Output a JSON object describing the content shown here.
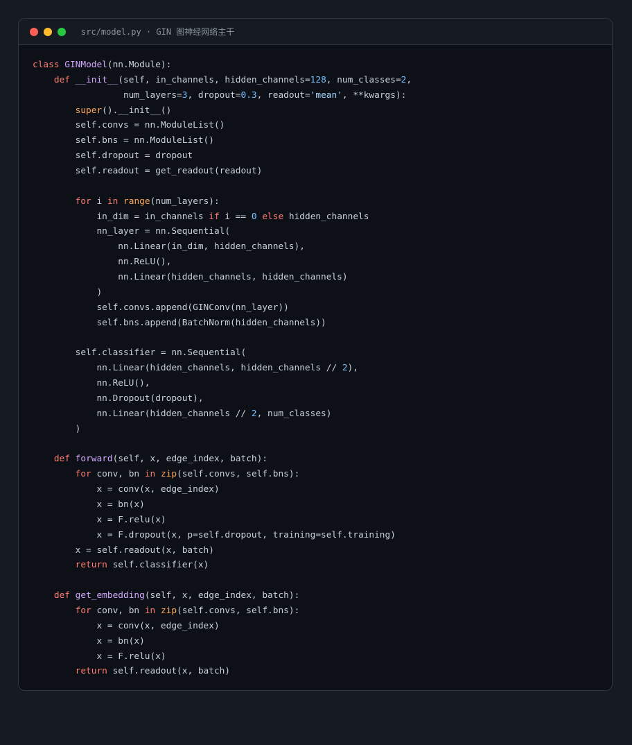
{
  "window": {
    "title": "src/model.py · GIN 图神经网络主干"
  },
  "colors": {
    "background": "#161b22",
    "editor_bg": "#0d1117",
    "text": "#c9d1d9",
    "keyword": "#ff7b72",
    "function": "#d2a8ff",
    "number": "#79c0ff",
    "string": "#a5d6ff",
    "builtin": "#ffa657"
  },
  "code_lines": [
    [
      [
        "kw",
        "class"
      ],
      [
        "p",
        " "
      ],
      [
        "fn",
        "GINModel"
      ],
      [
        "p",
        "(nn.Module):"
      ]
    ],
    [
      [
        "p",
        "    "
      ],
      [
        "kw",
        "def"
      ],
      [
        "p",
        " "
      ],
      [
        "fn",
        "__init__"
      ],
      [
        "p",
        "(self, in_channels, hidden_channels="
      ],
      [
        "num",
        "128"
      ],
      [
        "p",
        ", num_classes="
      ],
      [
        "num",
        "2"
      ],
      [
        "p",
        ","
      ]
    ],
    [
      [
        "p",
        "                 num_layers="
      ],
      [
        "num",
        "3"
      ],
      [
        "p",
        ", dropout="
      ],
      [
        "num",
        "0.3"
      ],
      [
        "p",
        ", readout="
      ],
      [
        "str",
        "'mean'"
      ],
      [
        "p",
        ", **kwargs):"
      ]
    ],
    [
      [
        "p",
        "        "
      ],
      [
        "bi",
        "super"
      ],
      [
        "p",
        "().__init__()"
      ]
    ],
    [
      [
        "p",
        "        self.convs = nn.ModuleList()"
      ]
    ],
    [
      [
        "p",
        "        self.bns = nn.ModuleList()"
      ]
    ],
    [
      [
        "p",
        "        self.dropout = dropout"
      ]
    ],
    [
      [
        "p",
        "        self.readout = get_readout(readout)"
      ]
    ],
    [],
    [
      [
        "p",
        "        "
      ],
      [
        "kw",
        "for"
      ],
      [
        "p",
        " i "
      ],
      [
        "kw",
        "in"
      ],
      [
        "p",
        " "
      ],
      [
        "bi",
        "range"
      ],
      [
        "p",
        "(num_layers):"
      ]
    ],
    [
      [
        "p",
        "            in_dim = in_channels "
      ],
      [
        "kw",
        "if"
      ],
      [
        "p",
        " i == "
      ],
      [
        "num",
        "0"
      ],
      [
        "p",
        " "
      ],
      [
        "kw",
        "else"
      ],
      [
        "p",
        " hidden_channels"
      ]
    ],
    [
      [
        "p",
        "            nn_layer = nn.Sequential("
      ]
    ],
    [
      [
        "p",
        "                nn.Linear(in_dim, hidden_channels),"
      ]
    ],
    [
      [
        "p",
        "                nn.ReLU(),"
      ]
    ],
    [
      [
        "p",
        "                nn.Linear(hidden_channels, hidden_channels)"
      ]
    ],
    [
      [
        "p",
        "            )"
      ]
    ],
    [
      [
        "p",
        "            self.convs.append(GINConv(nn_layer))"
      ]
    ],
    [
      [
        "p",
        "            self.bns.append(BatchNorm(hidden_channels))"
      ]
    ],
    [],
    [
      [
        "p",
        "        self.classifier = nn.Sequential("
      ]
    ],
    [
      [
        "p",
        "            nn.Linear(hidden_channels, hidden_channels // "
      ],
      [
        "num",
        "2"
      ],
      [
        "p",
        "),"
      ]
    ],
    [
      [
        "p",
        "            nn.ReLU(),"
      ]
    ],
    [
      [
        "p",
        "            nn.Dropout(dropout),"
      ]
    ],
    [
      [
        "p",
        "            nn.Linear(hidden_channels // "
      ],
      [
        "num",
        "2"
      ],
      [
        "p",
        ", num_classes)"
      ]
    ],
    [
      [
        "p",
        "        )"
      ]
    ],
    [],
    [
      [
        "p",
        "    "
      ],
      [
        "kw",
        "def"
      ],
      [
        "p",
        " "
      ],
      [
        "fn",
        "forward"
      ],
      [
        "p",
        "(self, x, edge_index, batch):"
      ]
    ],
    [
      [
        "p",
        "        "
      ],
      [
        "kw",
        "for"
      ],
      [
        "p",
        " conv, bn "
      ],
      [
        "kw",
        "in"
      ],
      [
        "p",
        " "
      ],
      [
        "bi",
        "zip"
      ],
      [
        "p",
        "(self.convs, self.bns):"
      ]
    ],
    [
      [
        "p",
        "            x = conv(x, edge_index)"
      ]
    ],
    [
      [
        "p",
        "            x = bn(x)"
      ]
    ],
    [
      [
        "p",
        "            x = F.relu(x)"
      ]
    ],
    [
      [
        "p",
        "            x = F.dropout(x, p=self.dropout, training=self.training)"
      ]
    ],
    [
      [
        "p",
        "        x = self.readout(x, batch)"
      ]
    ],
    [
      [
        "p",
        "        "
      ],
      [
        "kw",
        "return"
      ],
      [
        "p",
        " self.classifier(x)"
      ]
    ],
    [],
    [
      [
        "p",
        "    "
      ],
      [
        "kw",
        "def"
      ],
      [
        "p",
        " "
      ],
      [
        "fn",
        "get_embedding"
      ],
      [
        "p",
        "(self, x, edge_index, batch):"
      ]
    ],
    [
      [
        "p",
        "        "
      ],
      [
        "kw",
        "for"
      ],
      [
        "p",
        " conv, bn "
      ],
      [
        "kw",
        "in"
      ],
      [
        "p",
        " "
      ],
      [
        "bi",
        "zip"
      ],
      [
        "p",
        "(self.convs, self.bns):"
      ]
    ],
    [
      [
        "p",
        "            x = conv(x, edge_index)"
      ]
    ],
    [
      [
        "p",
        "            x = bn(x)"
      ]
    ],
    [
      [
        "p",
        "            x = F.relu(x)"
      ]
    ],
    [
      [
        "p",
        "        "
      ],
      [
        "kw",
        "return"
      ],
      [
        "p",
        " self.readout(x, batch)"
      ]
    ]
  ]
}
